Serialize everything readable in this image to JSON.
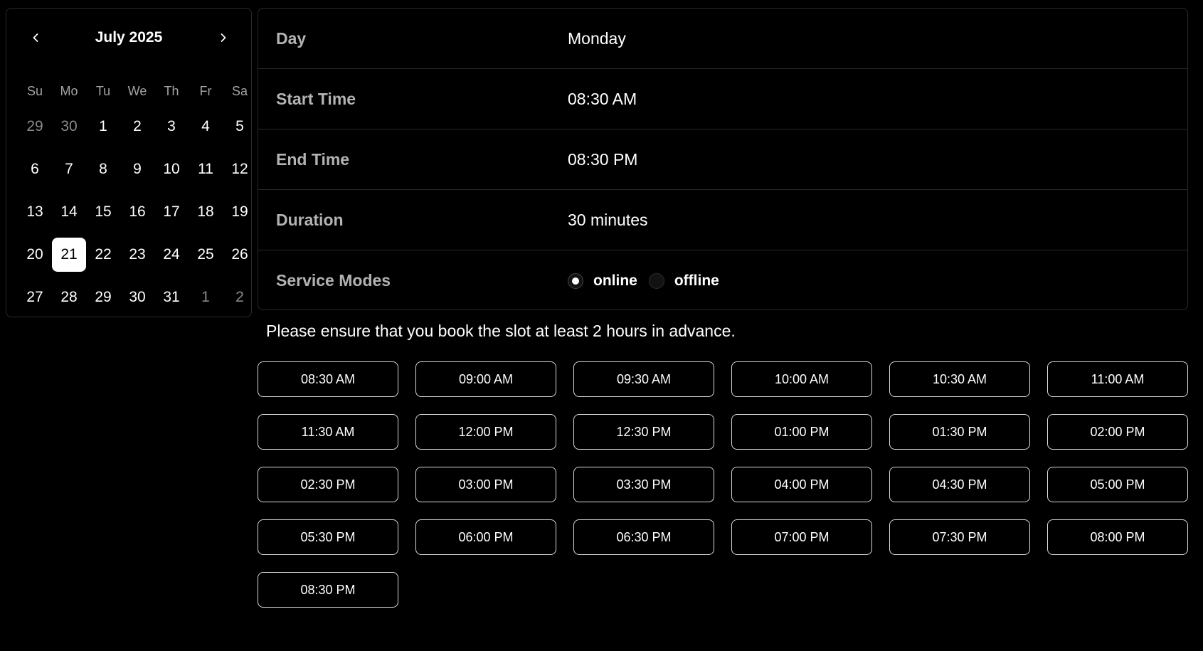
{
  "calendar": {
    "month_label": "July 2025",
    "weekdays": [
      "Su",
      "Mo",
      "Tu",
      "We",
      "Th",
      "Fr",
      "Sa"
    ],
    "weeks": [
      [
        {
          "d": "29",
          "outside": true
        },
        {
          "d": "30",
          "outside": true
        },
        {
          "d": "1"
        },
        {
          "d": "2"
        },
        {
          "d": "3"
        },
        {
          "d": "4"
        },
        {
          "d": "5"
        }
      ],
      [
        {
          "d": "6"
        },
        {
          "d": "7"
        },
        {
          "d": "8"
        },
        {
          "d": "9"
        },
        {
          "d": "10"
        },
        {
          "d": "11"
        },
        {
          "d": "12"
        }
      ],
      [
        {
          "d": "13"
        },
        {
          "d": "14"
        },
        {
          "d": "15"
        },
        {
          "d": "16"
        },
        {
          "d": "17"
        },
        {
          "d": "18"
        },
        {
          "d": "19"
        }
      ],
      [
        {
          "d": "20"
        },
        {
          "d": "21",
          "selected": true
        },
        {
          "d": "22"
        },
        {
          "d": "23"
        },
        {
          "d": "24"
        },
        {
          "d": "25"
        },
        {
          "d": "26"
        }
      ],
      [
        {
          "d": "27"
        },
        {
          "d": "28"
        },
        {
          "d": "29"
        },
        {
          "d": "30"
        },
        {
          "d": "31"
        },
        {
          "d": "1",
          "outside": true
        },
        {
          "d": "2",
          "outside": true
        }
      ]
    ],
    "prev_icon": "chevron-left-icon",
    "next_icon": "chevron-right-icon"
  },
  "details": {
    "day_label": "Day",
    "day_value": "Monday",
    "start_label": "Start Time",
    "start_value": "08:30 AM",
    "end_label": "End Time",
    "end_value": "08:30 PM",
    "duration_label": "Duration",
    "duration_value": "30 minutes",
    "modes_label": "Service Modes",
    "modes": [
      {
        "label": "online",
        "checked": true
      },
      {
        "label": "offline",
        "checked": false
      }
    ]
  },
  "notice": "Please ensure that you book the slot at least 2 hours in advance.",
  "slots": [
    "08:30 AM",
    "09:00 AM",
    "09:30 AM",
    "10:00 AM",
    "10:30 AM",
    "11:00 AM",
    "11:30 AM",
    "12:00 PM",
    "12:30 PM",
    "01:00 PM",
    "01:30 PM",
    "02:00 PM",
    "02:30 PM",
    "03:00 PM",
    "03:30 PM",
    "04:00 PM",
    "04:30 PM",
    "05:00 PM",
    "05:30 PM",
    "06:00 PM",
    "06:30 PM",
    "07:00 PM",
    "07:30 PM",
    "08:00 PM",
    "08:30 PM"
  ],
  "colors": {
    "background": "#000000",
    "border": "#2a2a2a",
    "muted_text": "#a3a3a3",
    "selected_bg": "#ffffff"
  }
}
